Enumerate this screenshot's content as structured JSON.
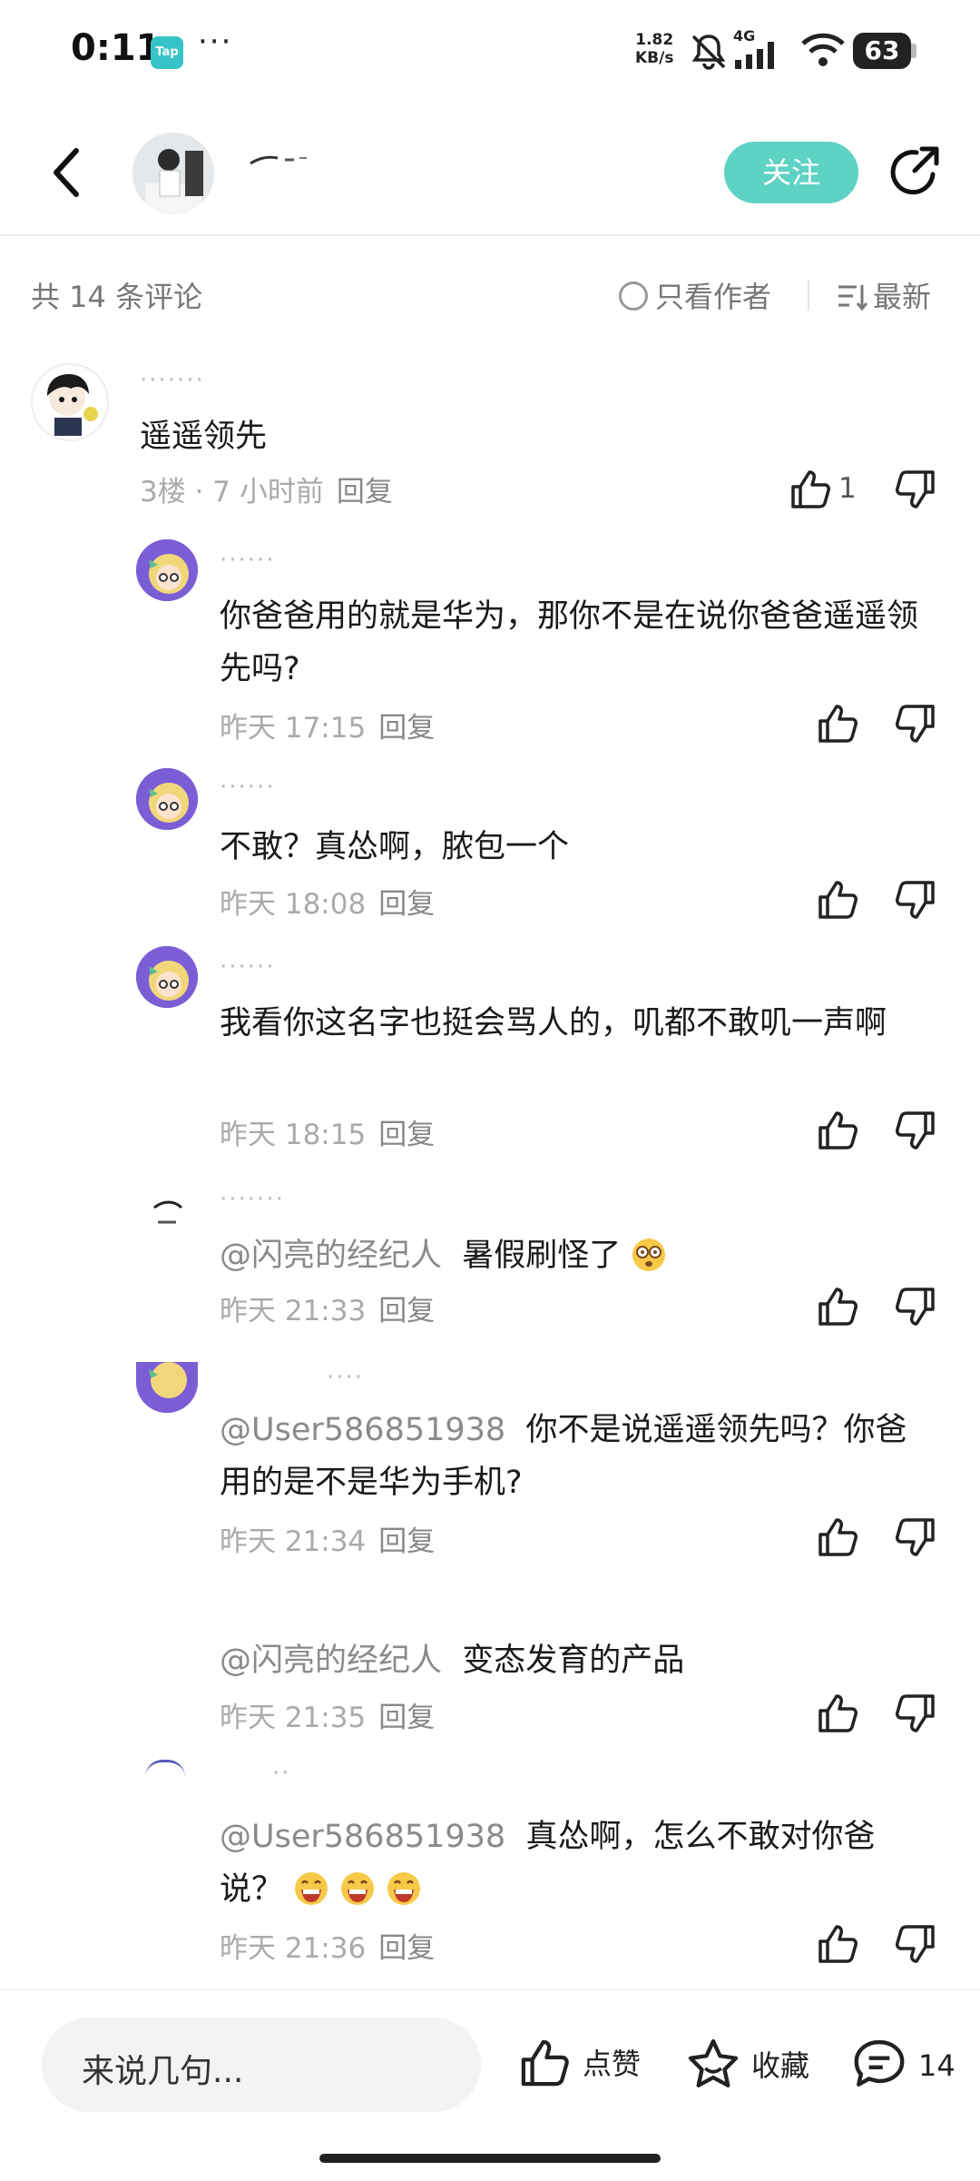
{
  "status_bar": {
    "time": "0:11",
    "app_badge": "Tap",
    "more": "···",
    "net_speed_value": "1.82",
    "net_speed_unit": "KB/s",
    "network_type": "4G",
    "battery": "63"
  },
  "header": {
    "follow_label": "关注"
  },
  "sort_bar": {
    "count_label": "共 14 条评论",
    "only_author_label": "只看作者",
    "sort_label": "最新"
  },
  "comments": [
    {
      "text": "遥遥领先",
      "floor_time": "3楼 · 7 小时前",
      "reply": "回复",
      "likes": "1"
    },
    {
      "text": "你爸爸用的就是华为，那你不是在说你爸爸遥遥领先吗?",
      "time": "昨天 17:15",
      "reply": "回复"
    },
    {
      "text": "不敢？真怂啊，脓包一个",
      "time": "昨天 18:08",
      "reply": "回复"
    },
    {
      "text": "我看你这名字也挺会骂人的，叽都不敢叽一声啊",
      "time": "昨天 18:15",
      "reply": "回复"
    },
    {
      "mention": "@闪亮的经纪人",
      "text": "暑假刷怪了",
      "time": "昨天 21:33",
      "reply": "回复"
    },
    {
      "mention": "@User586851938",
      "text": "你不是说遥遥领先吗？你爸用的是不是华为手机?",
      "time": "昨天 21:34",
      "reply": "回复"
    },
    {
      "mention": "@闪亮的经纪人",
      "text": "变态发育的产品",
      "time": "昨天 21:35",
      "reply": "回复"
    },
    {
      "mention": "@User586851938",
      "text": "真怂啊，怎么不敢对你爸说？",
      "time": "昨天 21:36",
      "reply": "回复"
    }
  ],
  "bottom_bar": {
    "input_placeholder": "来说几句...",
    "like_label": "点赞",
    "collect_label": "收藏",
    "comment_count": "14"
  },
  "colors": {
    "follow_button": "#5ed3c4",
    "text_primary": "#1a1a1a",
    "text_secondary": "#aaaaaa"
  }
}
